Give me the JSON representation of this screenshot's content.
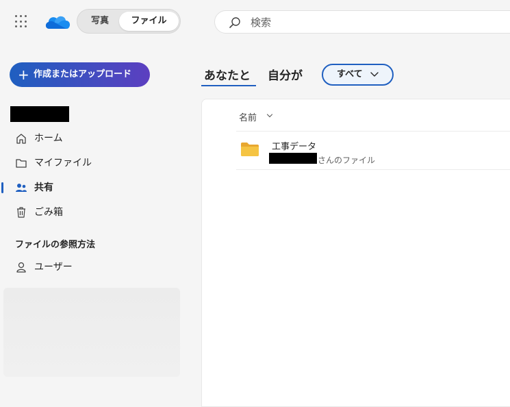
{
  "switcher": {
    "photos": "写真",
    "files": "ファイル"
  },
  "search": {
    "placeholder": "検索"
  },
  "sidebar": {
    "create_button": "作成またはアップロード",
    "items": [
      {
        "label": "ホーム",
        "icon": "home-icon"
      },
      {
        "label": "マイファイル",
        "icon": "folder-icon"
      },
      {
        "label": "共有",
        "icon": "people-icon",
        "active": true
      },
      {
        "label": "ごみ箱",
        "icon": "trash-icon"
      }
    ],
    "browse_heading": "ファイルの参照方法",
    "browse_items": [
      {
        "label": "ユーザー",
        "icon": "person-icon"
      }
    ]
  },
  "pivots": {
    "with_you": "あなたと",
    "by_you": "自分が"
  },
  "filter": {
    "label": "すべて"
  },
  "list": {
    "column_name": "名前",
    "rows": [
      {
        "name": "工事データ",
        "owner_suffix": "さんのファイル"
      }
    ]
  },
  "colors": {
    "accent": "#1f5fc0",
    "folder": "#f5c443"
  }
}
